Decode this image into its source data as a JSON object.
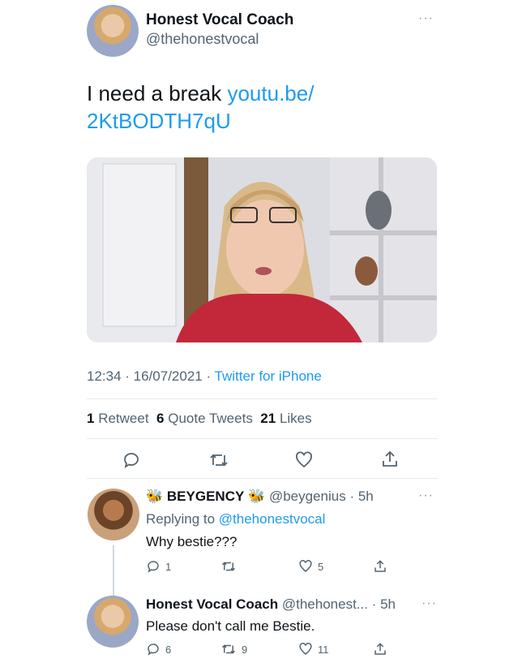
{
  "main_tweet": {
    "author_name": "Honest Vocal Coach",
    "author_handle": "@thehonestvocal",
    "text_prefix": "I need a break ",
    "link_line1": "youtu.be/",
    "link_line2": "2KtBODTH7qU",
    "timestamp": "12:34 · 16/07/2021 · ",
    "source": "Twitter for iPhone",
    "stats": {
      "retweets_count": "1",
      "retweets_label": "Retweet",
      "quotes_count": "6",
      "quotes_label": "Quote Tweets",
      "likes_count": "21",
      "likes_label": "Likes"
    }
  },
  "replies": [
    {
      "author_name": "BEYGENCY",
      "author_handle": "@beygenius · 5h",
      "replying_to_prefix": "Replying to ",
      "replying_to_handle": "@thehonestvocal",
      "text": "Why bestie???",
      "reply_count": "1",
      "retweet_count": "",
      "like_count": "5"
    },
    {
      "author_name": "Honest Vocal Coach",
      "author_handle": "@thehonest... · 5h",
      "text": "Please don't call me Bestie.",
      "reply_count": "6",
      "retweet_count": "9",
      "like_count": "11"
    }
  ],
  "glyphs": {
    "more": "···",
    "bee": "🐝"
  },
  "colors": {
    "link": "#1d9bf0",
    "muted": "#536471",
    "text": "#0f1419"
  }
}
